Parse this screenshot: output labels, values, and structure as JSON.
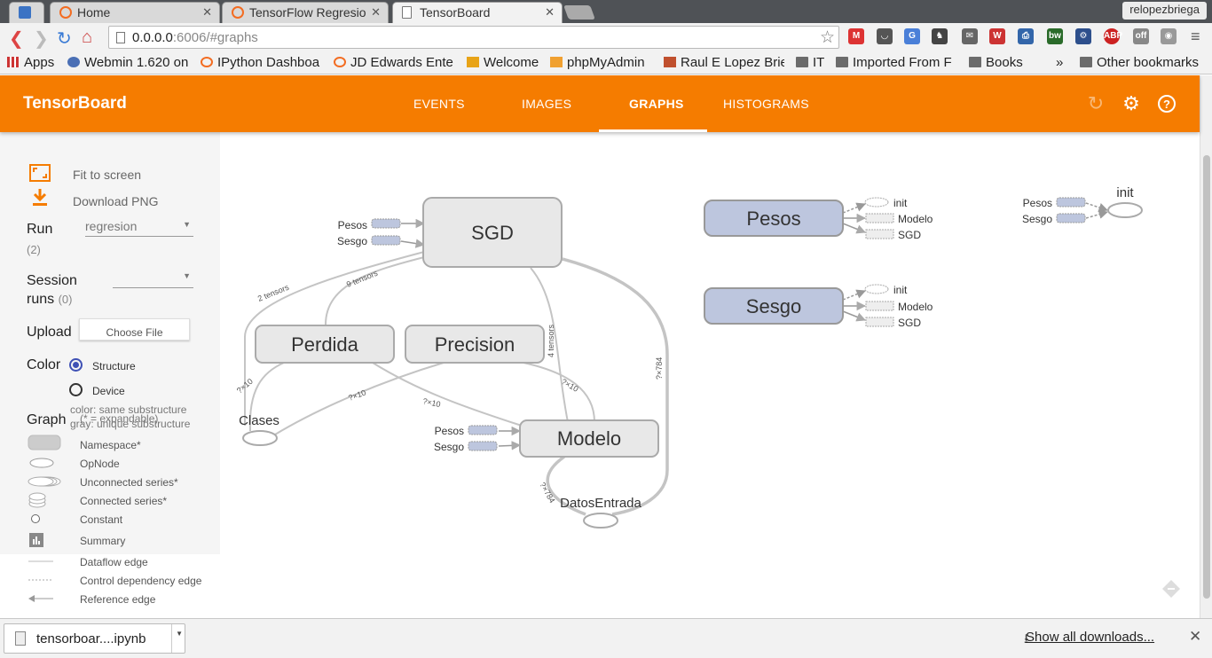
{
  "browser": {
    "tabs": [
      {
        "label": ""
      },
      {
        "label": "Home"
      },
      {
        "label": "TensorFlow Regresio"
      },
      {
        "label": "TensorBoard"
      }
    ],
    "profile": "relopezbriega",
    "url_host": "0.0.0.0",
    "url_rest": ":6006/#graphs",
    "bookmarks": [
      "Apps",
      "Webmin 1.620 on",
      "IPython Dashboa",
      "JD Edwards Ente",
      "Welcome",
      "phpMyAdmin",
      "Raul E Lopez Brie",
      "IT",
      "Imported From F",
      "Books",
      "Other bookmarks"
    ],
    "more": "»"
  },
  "header": {
    "title": "TensorBoard",
    "tabs": [
      "EVENTS",
      "IMAGES",
      "GRAPHS",
      "HISTOGRAMS"
    ],
    "selected_tab": "GRAPHS"
  },
  "sidebar": {
    "fit": "Fit to screen",
    "download": "Download PNG",
    "run_label": "Run",
    "run_count": "(2)",
    "run_value": "regresion",
    "session_label1": "Session",
    "session_label2": "runs",
    "session_count": "(0)",
    "upload_label": "Upload",
    "choose_file": "Choose File",
    "color_label": "Color",
    "color_structure": "Structure",
    "color_device": "Device",
    "color_note1": "color: same substructure",
    "color_note2": "gray: unique substructure",
    "graph_label": "Graph",
    "graph_note": "(* = expandable)",
    "legend": [
      "Namespace*",
      "OpNode",
      "Unconnected series*",
      "Connected series*",
      "Constant",
      "Summary",
      "Dataflow edge",
      "Control dependency edge",
      "Reference edge"
    ]
  },
  "graph": {
    "nodes": {
      "sgd": "SGD",
      "perdida": "Perdida",
      "precision": "Precision",
      "modelo": "Modelo",
      "pesos": "Pesos",
      "sesgo": "Sesgo",
      "clases": "Clases",
      "datos": "DatosEntrada",
      "init": "init"
    },
    "aux": {
      "pesos": "Pesos",
      "sesgo": "Sesgo",
      "init": "init",
      "modelo": "Modelo",
      "sgd": "SGD"
    },
    "edge_labels": {
      "e1": "2 tensors",
      "e2": "9 tensors",
      "e3": "4 tensors",
      "e4": "?×784",
      "e5": "?×10",
      "e6": "?×10",
      "e7": "?×10",
      "e8": "?×10",
      "e9": "?×784"
    }
  },
  "downloads": {
    "file": "tensorboar....ipynb",
    "show_all": "Show all downloads..."
  },
  "colors": {
    "accent": "#f57c00",
    "node_fill": "#e8e8e8",
    "highlight_fill": "#bdc6de"
  }
}
